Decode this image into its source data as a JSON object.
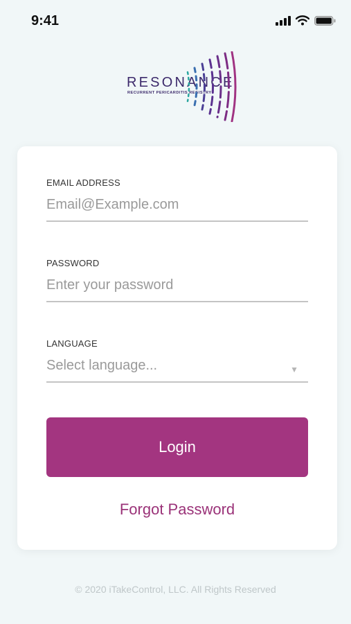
{
  "status_bar": {
    "time": "9:41",
    "icons": [
      "signal-icon",
      "wifi-icon",
      "battery-icon"
    ]
  },
  "logo": {
    "word": "RESONANCE",
    "subtitle": "RECURRENT PERICARDITIS REGISTRY"
  },
  "form": {
    "email": {
      "label": "EMAIL ADDRESS",
      "placeholder": "Email@Example.com"
    },
    "password": {
      "label": "PASSWORD",
      "placeholder": "Enter your password"
    },
    "language": {
      "label": "LANGUAGE",
      "placeholder": "Select language...",
      "icon": "chevron-down-icon"
    },
    "login_label": "Login",
    "forgot_label": "Forgot Password"
  },
  "footer": {
    "copyright": "© 2020 iTakeControl, LLC.  All Rights Reserved"
  },
  "colors": {
    "accent": "#a33580",
    "background": "#f1f7f8",
    "logo_text": "#3c2a6b"
  }
}
